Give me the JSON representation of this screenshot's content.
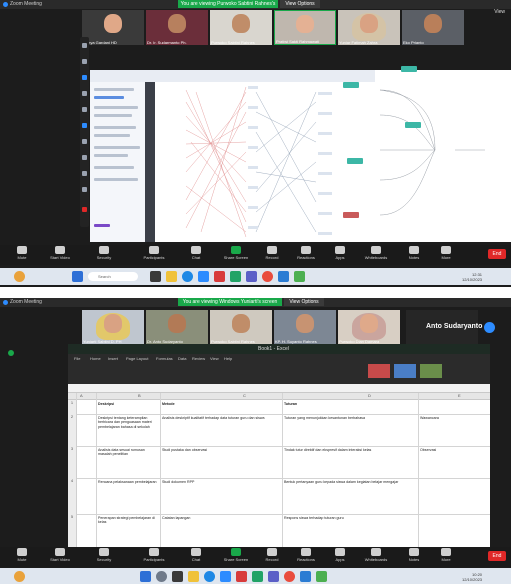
{
  "screen1": {
    "window_title": "Zoom Meeting",
    "share_status": "You are viewing Purwoko Sabtini Rahnes's screen",
    "view_options": "View Options",
    "view_right": "View",
    "participants": [
      {
        "name": "Cahya Gardani HD"
      },
      {
        "name": "Dr. Ir. Sudarmanto Ph."
      },
      {
        "name": "Purwoko Sabtini Rahnes"
      },
      {
        "name": "Pratiwi Sakti Rahmawati"
      },
      {
        "name": "Yuniar Fatimah Zahra"
      },
      {
        "name": "Eko Prianto"
      }
    ],
    "controls": [
      "Mute",
      "Start Video",
      "Security",
      "Participants",
      "Chat",
      "Share Screen",
      "Record",
      "Reactions",
      "Apps",
      "Whiteboards",
      "Notes",
      "More"
    ],
    "end_label": "End",
    "search_placeholder": "Search",
    "tray_time": "12:31",
    "tray_date": "12/10/2023"
  },
  "screen2": {
    "window_title": "Zoom Meeting",
    "share_status": "You are viewing Windows Yuniarti's screen",
    "view_options": "View Options",
    "speaker_name": "Anto Sudaryanto",
    "participants": [
      {
        "name": "Yuniarti Sabtini D. PH"
      },
      {
        "name": "Dr. Anto Sudaryanto"
      },
      {
        "name": "Purwoko Sabtini Rahnes"
      },
      {
        "name": "KP. H. Suyanto Rahnes"
      },
      {
        "name": "Purwoko Dian Damara"
      }
    ],
    "excel_title": "Book1 - Excel",
    "ribbon_tabs": [
      "File",
      "Home",
      "Insert",
      "Page Layout",
      "Formulas",
      "Data",
      "Review",
      "View",
      "Help"
    ],
    "columns": [
      "A",
      "B",
      "C",
      "D",
      "E"
    ],
    "rows": [
      {
        "num": "1",
        "b": "Deskripsi",
        "c": "Metode",
        "d": "Tuturan",
        "e": ""
      },
      {
        "num": "2",
        "b": "Deskripsi tentang keterampilan berbicara dan penguasaan materi pembelajaran bahasa di sekolah",
        "c": "Analisis deskriptif kualitatif terhadap data tuturan guru dan siswa",
        "d": "Tuturan yang menunjukkan kesantunan berbahasa",
        "e": "Wawancara"
      },
      {
        "num": "3",
        "b": "Analisis data sesuai rumusan masalah penelitian",
        "c": "Studi pustaka dan observasi",
        "d": "Tindak tutur direktif dan ekspresif dalam interaksi kelas",
        "e": "Observasi"
      },
      {
        "num": "4",
        "b": "Rencana pelaksanaan pembelajaran",
        "c": "Studi dokumen RPP",
        "d": "Bentuk pertanyaan guru kepada siswa dalam kegiatan belajar mengajar",
        "e": ""
      },
      {
        "num": "5",
        "b": "Penerapan strategi pembelajaran di kelas",
        "c": "Catatan lapangan",
        "d": "Respons siswa terhadap tuturan guru",
        "e": ""
      }
    ],
    "controls": [
      "Mute",
      "Start Video",
      "Security",
      "Participants",
      "Chat",
      "Share Screen",
      "Record",
      "Reactions",
      "Apps",
      "Whiteboards",
      "Notes",
      "More"
    ],
    "end_label": "End",
    "tray_time": "10:20",
    "tray_date": "12/10/2023"
  }
}
